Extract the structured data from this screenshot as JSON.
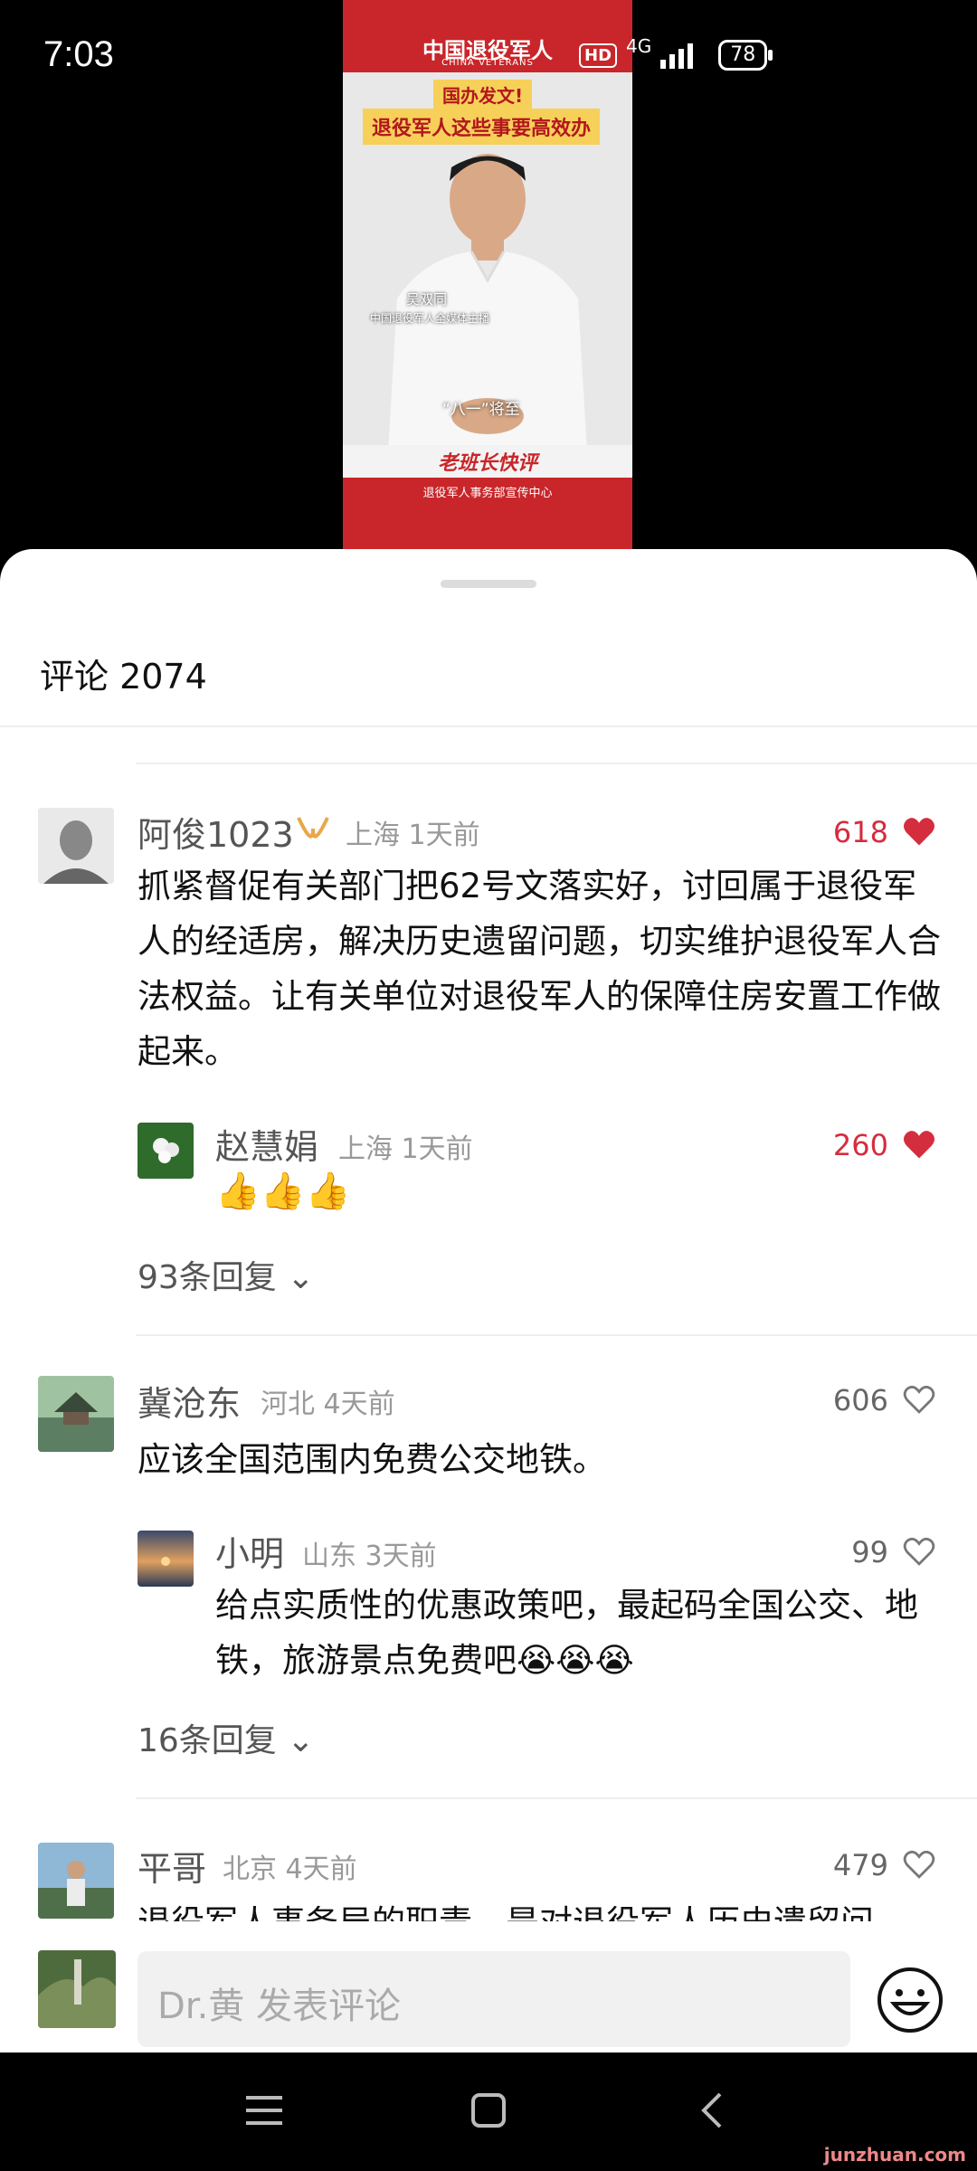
{
  "status": {
    "time": "7:03",
    "hd": "HD",
    "network": "4G",
    "battery": "78"
  },
  "video": {
    "brand": "中国退役军人",
    "brand_sub": "CHINA VETERANS",
    "headline1": "国办发文!",
    "headline2": "退役军人这些事要高效办",
    "speaker_name": "吴双同",
    "speaker_title": "中国退役军人全媒体主播",
    "subtitle": "“八一”将至",
    "banner": "老班长快评",
    "footer": "退役军人事务部宣传中心"
  },
  "comments_header": {
    "title": "评论 2074"
  },
  "comments": [
    {
      "name": "阿俊1023",
      "location": "上海",
      "time": "1天前",
      "likes": "618",
      "liked": true,
      "text": "抓紧督促有关部门把62号文落实好，讨回属于退役军人的经适房，解决历史遗留问题，切实维护退役军人合法权益。让有关单位对退役军人的保障住房安置工作做起来。",
      "reply": {
        "name": "赵慧娟",
        "location": "上海",
        "time": "1天前",
        "likes": "260",
        "liked": true,
        "text": "👍👍👍"
      },
      "more_replies": "93条回复"
    },
    {
      "name": "冀沧东",
      "location": "河北",
      "time": "4天前",
      "likes": "606",
      "liked": false,
      "text": "应该全国范围内免费公交地铁。",
      "reply": {
        "name": "小明",
        "location": "山东",
        "time": "3天前",
        "likes": "99",
        "liked": false,
        "text": "给点实质性的优惠政策吧，最起码全国公交、地铁，旅游景点免费吧😭😭😭"
      },
      "more_replies": "16条回复"
    },
    {
      "name": "平哥",
      "location": "北京",
      "time": "4天前",
      "likes": "479",
      "liked": false,
      "text": "退役军人事务局的职责，是对退役军人历史遗留问"
    }
  ],
  "input": {
    "placeholder": "Dr.黄 发表评论"
  },
  "watermark": "junzhuan.com",
  "colors": {
    "like_red": "#d42d3e",
    "brand_red": "#c8262a"
  }
}
